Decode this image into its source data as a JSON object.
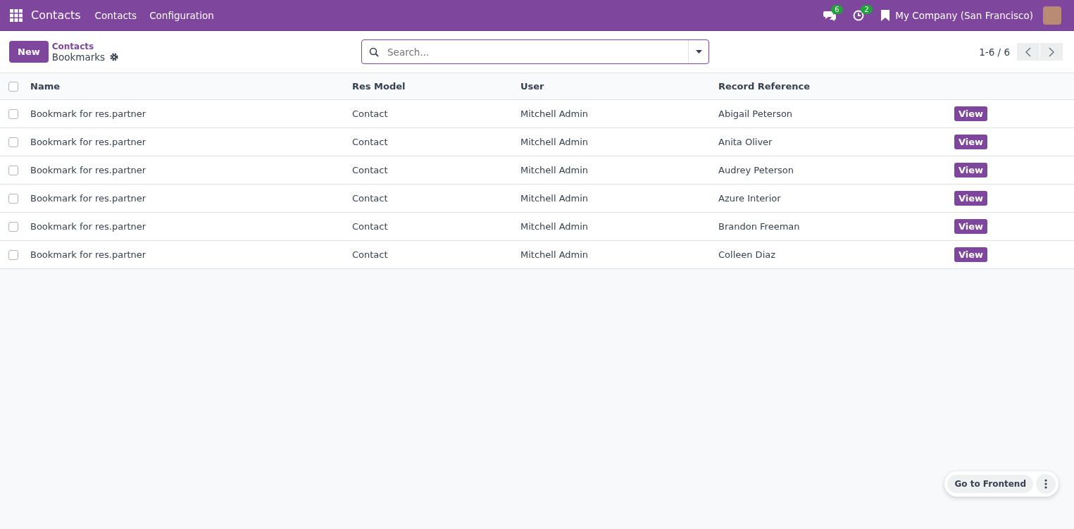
{
  "navbar": {
    "app_name": "Contacts",
    "menu": [
      "Contacts",
      "Configuration"
    ],
    "messages_count": "6",
    "activities_count": "2",
    "company": "My Company (San Francisco)"
  },
  "control_panel": {
    "new_button": "New",
    "breadcrumb": "Contacts",
    "title": "Bookmarks",
    "search": {
      "placeholder": "Search..."
    },
    "pager": "1-6 / 6"
  },
  "table": {
    "columns": [
      "Name",
      "Res Model",
      "User",
      "Record Reference"
    ],
    "all_selected": false,
    "rows": [
      {
        "name": "Bookmark for res.partner",
        "res_model": "Contact",
        "user": "Mitchell Admin",
        "record_reference": "Abigail Peterson",
        "action": "View",
        "selected": false
      },
      {
        "name": "Bookmark for res.partner",
        "res_model": "Contact",
        "user": "Mitchell Admin",
        "record_reference": "Anita Oliver",
        "action": "View",
        "selected": false
      },
      {
        "name": "Bookmark for res.partner",
        "res_model": "Contact",
        "user": "Mitchell Admin",
        "record_reference": "Audrey Peterson",
        "action": "View",
        "selected": false
      },
      {
        "name": "Bookmark for res.partner",
        "res_model": "Contact",
        "user": "Mitchell Admin",
        "record_reference": "Azure Interior",
        "action": "View",
        "selected": false
      },
      {
        "name": "Bookmark for res.partner",
        "res_model": "Contact",
        "user": "Mitchell Admin",
        "record_reference": "Brandon Freeman",
        "action": "View",
        "selected": false
      },
      {
        "name": "Bookmark for res.partner",
        "res_model": "Contact",
        "user": "Mitchell Admin",
        "record_reference": "Colleen Diaz",
        "action": "View",
        "selected": false
      }
    ]
  },
  "floating": {
    "button": "Go to Frontend"
  }
}
